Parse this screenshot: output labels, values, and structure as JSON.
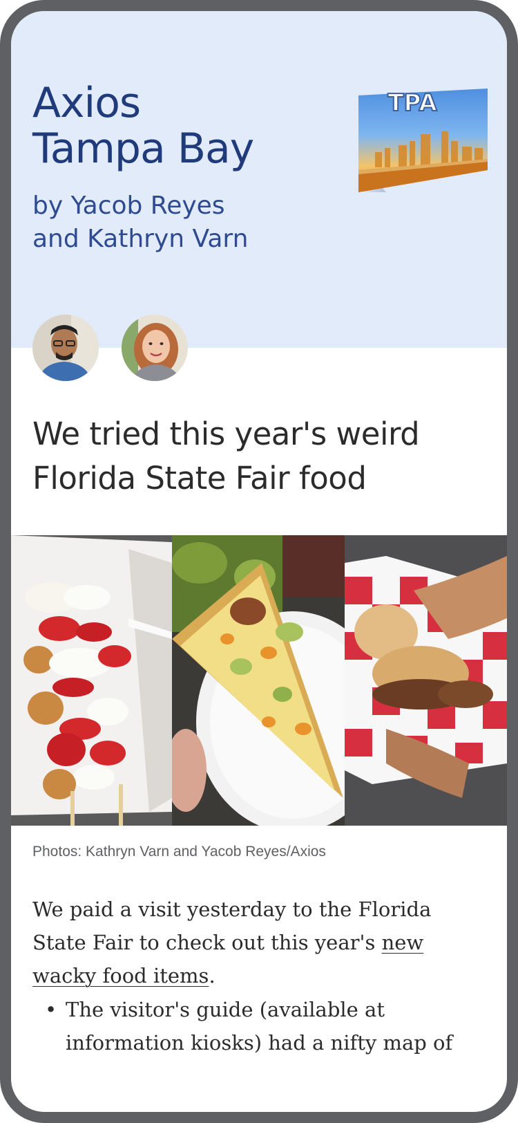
{
  "newsletter": {
    "title_line1": "Axios",
    "title_line2": "Tampa Bay",
    "byline_line1": "by Yacob Reyes",
    "byline_line2": "and Kathryn Varn",
    "postcard_text": "TPA",
    "colors": {
      "hero_bg": "#e1ebf9",
      "brand": "#1f3b7c"
    }
  },
  "authors": [
    {
      "name": "Yacob Reyes"
    },
    {
      "name": "Kathryn Varn"
    }
  ],
  "article": {
    "headline_line1": "We tried this year's weird",
    "headline_line2": "Florida State Fair food",
    "photo_caption": "Photos: Kathryn Varn and Yacob Reyes/Axios",
    "paragraph_before_link": "We paid a visit yesterday to the Florida State Fair to check out this year's ",
    "paragraph_link": "new wacky food items",
    "paragraph_after_link": ".",
    "bullet_text": "The visitor's guide (available at information kiosks) had a nifty map of"
  }
}
